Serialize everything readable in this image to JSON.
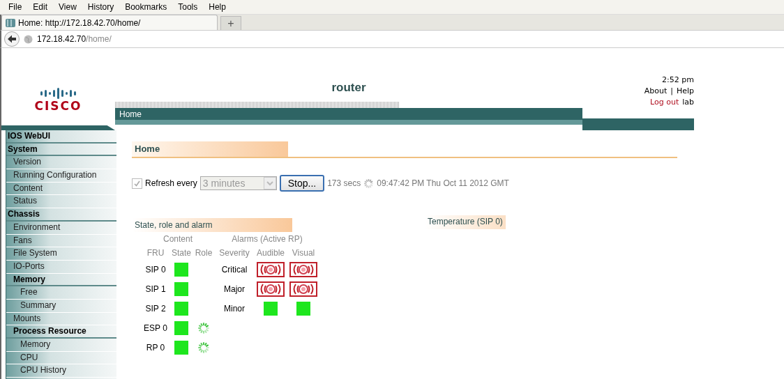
{
  "browser": {
    "menu": [
      "File",
      "Edit",
      "View",
      "History",
      "Bookmarks",
      "Tools",
      "Help"
    ],
    "tabs": [
      {
        "title": "Home: http://172.18.42.70/home/",
        "selected": true
      }
    ],
    "new_tab": "+",
    "url": {
      "host": "172.18.42.70",
      "path": "/home/"
    }
  },
  "header": {
    "logo_text": "CISCO",
    "title": "router",
    "time": "2:52 pm",
    "links": [
      "About",
      "Help"
    ],
    "separator": "|",
    "logout": "Log out",
    "user": "lab",
    "nav": "Home"
  },
  "sidebar": {
    "title": "IOS WebUI",
    "sections": [
      {
        "label": "System",
        "children": [
          {
            "label": "Version"
          },
          {
            "label": "Running Configuration"
          },
          {
            "label": "Content"
          },
          {
            "label": "Status"
          }
        ]
      },
      {
        "label": "Chassis",
        "children": [
          {
            "label": "Environment"
          },
          {
            "label": "Fans"
          },
          {
            "label": "File System"
          },
          {
            "label": "IO-Ports"
          },
          {
            "label": "Memory",
            "children": [
              {
                "label": "Free"
              },
              {
                "label": "Summary"
              }
            ]
          },
          {
            "label": "Mounts"
          },
          {
            "label": "Process Resource",
            "children": [
              {
                "label": "Memory"
              },
              {
                "label": "CPU"
              },
              {
                "label": "CPU History"
              }
            ]
          }
        ]
      }
    ]
  },
  "page": {
    "heading": "Home",
    "refresh": {
      "checked": true,
      "label": "Refresh every",
      "interval": "3 minutes",
      "disabled": true,
      "button": "Stop...",
      "countdown": "173 secs",
      "timestamp": "09:47:42 PM Thu Oct 11 2012 GMT"
    },
    "status_panel": {
      "title": "State, role and alarm",
      "group_headers": [
        "Content",
        "Alarms (Active RP)"
      ],
      "columns": [
        "FRU",
        "State",
        "Role",
        "Severity",
        "Audible",
        "Visual"
      ],
      "frus": [
        {
          "name": "SIP 0",
          "state_ok": true,
          "role_busy": false
        },
        {
          "name": "SIP 1",
          "state_ok": true,
          "role_busy": false
        },
        {
          "name": "SIP 2",
          "state_ok": true,
          "role_busy": false
        },
        {
          "name": "ESP 0",
          "state_ok": true,
          "role_busy": true
        },
        {
          "name": "RP 0",
          "state_ok": true,
          "role_busy": true
        }
      ],
      "alarms": [
        {
          "severity": "Critical",
          "audible_alarm": true,
          "visual_alarm": true
        },
        {
          "severity": "Major",
          "audible_alarm": true,
          "visual_alarm": true
        },
        {
          "severity": "Minor",
          "audible_alarm": false,
          "visual_alarm": false
        }
      ]
    },
    "temperature_panel": {
      "title": "Temperature (SIP 0)"
    }
  }
}
